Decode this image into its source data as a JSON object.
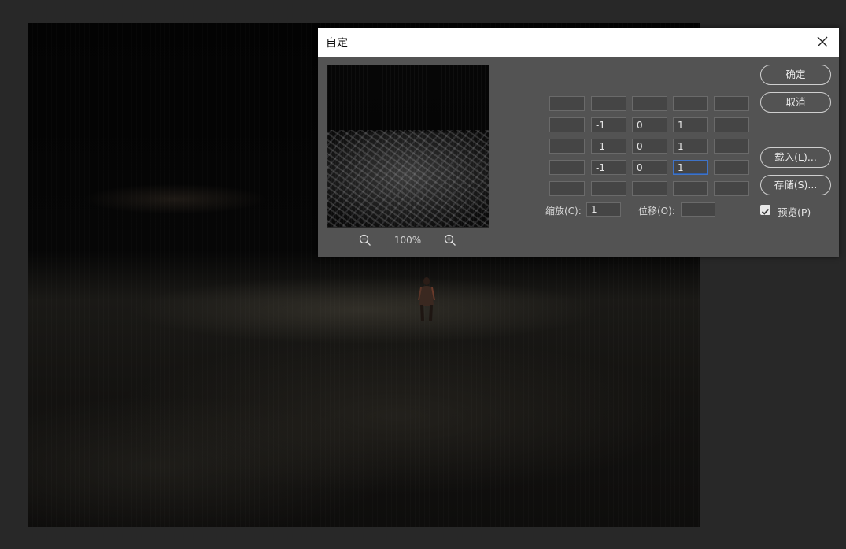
{
  "dialog": {
    "title": "自定",
    "zoom_level": "100%",
    "matrix": [
      [
        "",
        "",
        "",
        "",
        ""
      ],
      [
        "",
        "-1",
        "0",
        "1",
        ""
      ],
      [
        "",
        "-1",
        "0",
        "1",
        ""
      ],
      [
        "",
        "-1",
        "0",
        "1",
        ""
      ],
      [
        "",
        "",
        "",
        "",
        ""
      ]
    ],
    "scale_label": "缩放(C):",
    "scale_value": "1",
    "offset_label": "位移(O):",
    "offset_value": "",
    "buttons": {
      "ok": "确定",
      "cancel": "取消",
      "load": "载入(L)...",
      "save": "存储(S)..."
    },
    "preview_label": "预览(P)",
    "preview_checked": true
  },
  "icons": {
    "close": "close-icon",
    "zoom_out": "zoom-out-icon",
    "zoom_in": "zoom-in-icon",
    "check": "check-icon"
  },
  "colors": {
    "dialog_bg": "#535353",
    "app_bg": "#282828",
    "active_field": "#3f73c7"
  }
}
